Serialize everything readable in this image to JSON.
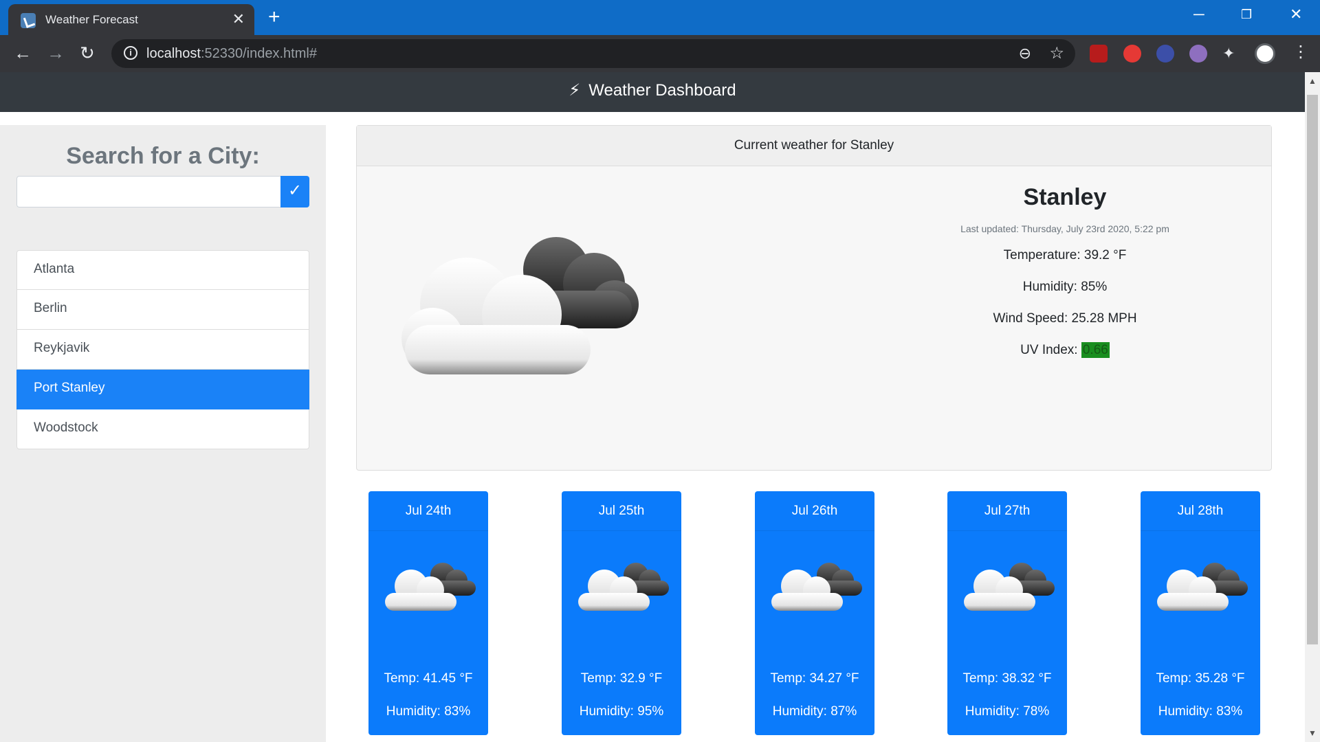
{
  "browser": {
    "tab_title": "Weather Forecast",
    "url_host": "localhost",
    "url_rest": ":52330/index.html#"
  },
  "app": {
    "brand": "Weather Dashboard"
  },
  "search": {
    "heading": "Search for a City:",
    "value": ""
  },
  "cities": [
    "Atlanta",
    "Berlin",
    "Reykjavik",
    "Port Stanley",
    "Woodstock"
  ],
  "current": {
    "header": "Current weather for Stanley",
    "city": "Stanley",
    "updated": "Last updated: Thursday, July 23rd 2020, 5:22 pm",
    "temperature": "Temperature: 39.2 °F",
    "humidity": "Humidity: 85%",
    "wind": "Wind Speed: 25.28 MPH",
    "uv_label": "UV Index:",
    "uv_value": "0.66"
  },
  "forecast": [
    {
      "date": "Jul 24th",
      "temp": "Temp: 41.45 °F",
      "humidity": "Humidity: 83%"
    },
    {
      "date": "Jul 25th",
      "temp": "Temp: 32.9 °F",
      "humidity": "Humidity: 95%"
    },
    {
      "date": "Jul 26th",
      "temp": "Temp: 34.27 °F",
      "humidity": "Humidity: 87%"
    },
    {
      "date": "Jul 27th",
      "temp": "Temp: 38.32 °F",
      "humidity": "Humidity: 78%"
    },
    {
      "date": "Jul 28th",
      "temp": "Temp: 35.28 °F",
      "humidity": "Humidity: 83%"
    }
  ],
  "colors": {
    "accent": "#1a82f7",
    "navbar": "#343a40",
    "uv_badge": "#198e1f",
    "forecast_card": "#0b7bfb"
  },
  "icons": {
    "weather": "cloudy-icon"
  }
}
